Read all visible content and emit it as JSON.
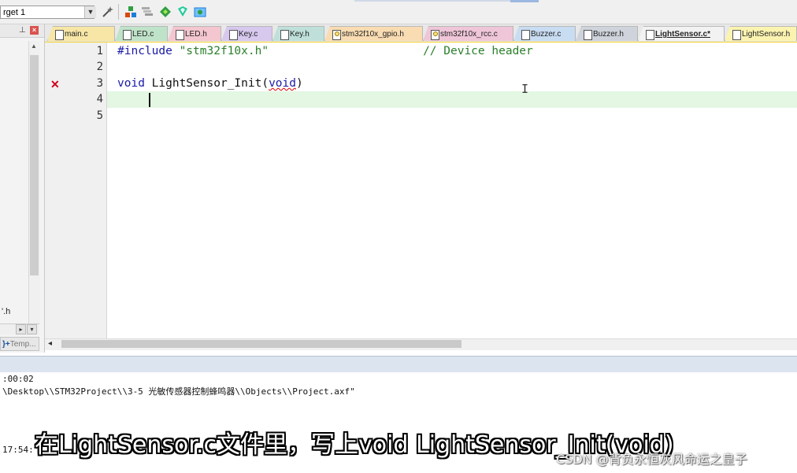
{
  "toolbar": {
    "target": "rget 1",
    "buttons": [
      "magic-wand-icon",
      "manage-components-icon",
      "select-packs-icon",
      "pack-installer-icon",
      "debug-settings-icon",
      "manage-run-time-icon"
    ]
  },
  "left_panel": {
    "file_label": "'.h",
    "tab_label": "Temp..."
  },
  "tabs": [
    {
      "label": "main.c",
      "color": "#f7e6a6",
      "icon": "file"
    },
    {
      "label": "LED.c",
      "color": "#bfe3c9",
      "icon": "file"
    },
    {
      "label": "LED.h",
      "color": "#f4c6cf",
      "icon": "file"
    },
    {
      "label": "Key.c",
      "color": "#d7c8ee",
      "icon": "file"
    },
    {
      "label": "Key.h",
      "color": "#bfe0da",
      "icon": "file"
    },
    {
      "label": "stm32f10x_gpio.h",
      "color": "#f9dcb2",
      "icon": "gear"
    },
    {
      "label": "stm32f10x_rcc.c",
      "color": "#efc6d8",
      "icon": "gear"
    },
    {
      "label": "Buzzer.c",
      "color": "#c8dcf2",
      "icon": "file"
    },
    {
      "label": "Buzzer.h",
      "color": "#cfd3db",
      "icon": "file"
    },
    {
      "label": "LightSensor.c*",
      "color": "#f2f2f2",
      "icon": "file"
    },
    {
      "label": "LightSensor.h",
      "color": "#fbf3b0",
      "icon": "file"
    }
  ],
  "editor": {
    "line_numbers": [
      "1",
      "2",
      "3",
      "4",
      "5"
    ],
    "line1": {
      "directive": "#include",
      "file": "\"stm32f10x.h\"",
      "comment": "// Device header"
    },
    "line3": {
      "keyword": "void",
      "name": " LightSensor_Init(",
      "param": "void",
      "close": ")"
    },
    "error_marker": "✕"
  },
  "output": {
    "line1": ":00:02",
    "line2": "\\Desktop\\\\STM32Project\\\\3-5 光敏传感器控制蜂鸣器\\\\Objects\\\\Project.axf\"",
    "line3": "17:54:"
  },
  "overlay": {
    "subtitle": "在LightSensor.c文件里，写上void LightSensor_Init(void)",
    "watermark": "CSDN @背负永恒灰风命运之皇子"
  }
}
